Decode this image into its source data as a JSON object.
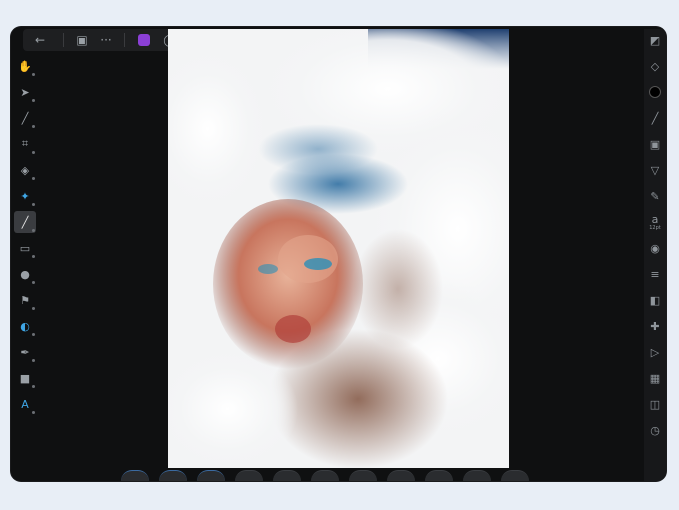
{
  "app": {
    "name": "Photo editor (iPad)",
    "accent_color": "#8b3fd6",
    "canvas_background": "#f2f3f4"
  },
  "topbar": {
    "back_icon": "←",
    "items": [
      {
        "name": "document-icon",
        "glyph": "▣"
      },
      {
        "name": "more-icon",
        "glyph": "···"
      }
    ],
    "personas": [
      {
        "name": "photo-persona-icon",
        "glyph": "■",
        "active": true
      },
      {
        "name": "liquify-persona-icon",
        "glyph": "◯"
      },
      {
        "name": "develop-persona-icon",
        "glyph": "◑"
      },
      {
        "name": "tone-mapping-persona-icon",
        "glyph": "⬡"
      },
      {
        "name": "export-persona-icon",
        "glyph": "⋈"
      },
      {
        "name": "layers-persona-icon",
        "glyph": "▤"
      }
    ]
  },
  "left_tools": [
    {
      "name": "hand-tool-icon",
      "glyph": "✋"
    },
    {
      "name": "move-tool-icon",
      "glyph": "➤"
    },
    {
      "name": "color-picker-tool-icon",
      "glyph": "╱"
    },
    {
      "name": "crop-tool-icon",
      "glyph": "⌗"
    },
    {
      "name": "flood-fill-tool-icon",
      "glyph": "◈"
    },
    {
      "name": "selection-brush-tool-icon",
      "glyph": "✦",
      "blue": true
    },
    {
      "name": "paint-brush-tool-icon",
      "glyph": "╱",
      "active": true
    },
    {
      "name": "erase-brush-tool-icon",
      "glyph": "▭"
    },
    {
      "name": "dodge-tool-icon",
      "glyph": "●"
    },
    {
      "name": "clone-tool-icon",
      "glyph": "⚑"
    },
    {
      "name": "smudge-tool-icon",
      "glyph": "◐",
      "blue": true
    },
    {
      "name": "pen-tool-icon",
      "glyph": "✒"
    },
    {
      "name": "rectangle-tool-icon",
      "glyph": "■"
    },
    {
      "name": "artistic-text-tool-icon",
      "glyph": "A",
      "blue": true
    }
  ],
  "right_tools": [
    {
      "name": "layers-panel-icon",
      "glyph": "◩"
    },
    {
      "name": "layer-stack-icon",
      "glyph": "◇"
    },
    {
      "name": "color-swatch-icon",
      "type": "dot"
    },
    {
      "name": "brushes-panel-icon",
      "glyph": "╱"
    },
    {
      "name": "adjustments-panel-icon",
      "glyph": "▣"
    },
    {
      "name": "filters-panel-icon",
      "glyph": "▽"
    },
    {
      "name": "fx-panel-icon",
      "glyph": "✎"
    },
    {
      "name": "text-panel-icon",
      "glyph": "a",
      "sub": "12pt"
    },
    {
      "name": "camera-panel-icon",
      "glyph": "◉"
    },
    {
      "name": "transform-panel-icon",
      "glyph": "≡"
    },
    {
      "name": "history-stack-icon",
      "glyph": "◧"
    },
    {
      "name": "navigator-icon",
      "glyph": "✚"
    },
    {
      "name": "play-icon",
      "glyph": "▷"
    },
    {
      "name": "grid-icon",
      "glyph": "▦"
    },
    {
      "name": "snapshot-icon",
      "glyph": "◫"
    },
    {
      "name": "history-clock-icon",
      "glyph": "◷"
    }
  ],
  "bottom_bar_count": 11
}
